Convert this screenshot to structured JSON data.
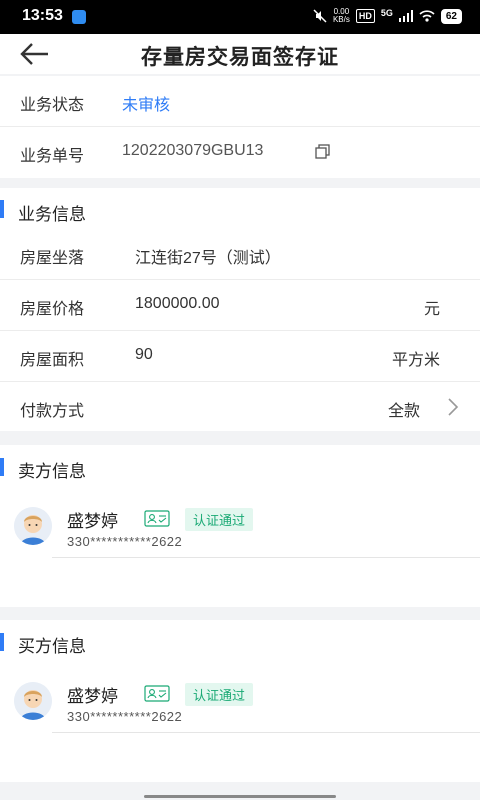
{
  "status_bar": {
    "time": "13:53",
    "net_speed_value": "0.00",
    "net_speed_unit": "KB/s",
    "hd_badge": "HD",
    "network": "5G",
    "battery": "62",
    "icons": [
      "app-notification-icon",
      "mute-icon",
      "signal-icon",
      "wifi-icon",
      "battery-icon"
    ]
  },
  "nav": {
    "title": "存量房交易面签存证",
    "back_icon": "arrow-left-icon"
  },
  "business": {
    "status_label": "业务状态",
    "status_value": "未审核",
    "status_color": "#2f7cf6",
    "order_label": "业务单号",
    "order_value": "1202203079GBU13",
    "copy_icon": "copy-icon"
  },
  "business_info": {
    "title": "业务信息",
    "accent": "#2f7cf6",
    "rows": [
      {
        "label": "房屋坐落",
        "value": "江连街27号（测试）",
        "unit": ""
      },
      {
        "label": "房屋价格",
        "value": "1800000.00",
        "unit": "元"
      },
      {
        "label": "房屋面积",
        "value": "90",
        "unit": "平方米"
      },
      {
        "label": "付款方式",
        "value": "",
        "unit": "全款"
      }
    ],
    "chevron_icon": "chevron-right-icon"
  },
  "seller": {
    "title": "卖方信息",
    "name": "盛梦婷",
    "cert_status": "认证通过",
    "id_number": "330***********2622",
    "id_icon": "id-card-icon"
  },
  "buyer": {
    "title": "买方信息",
    "name": "盛梦婷",
    "cert_status": "认证通过",
    "id_number": "330***********2622",
    "id_icon": "id-card-icon"
  },
  "colors": {
    "cert_bg": "#e3f7ef",
    "cert_text": "#19a974"
  }
}
